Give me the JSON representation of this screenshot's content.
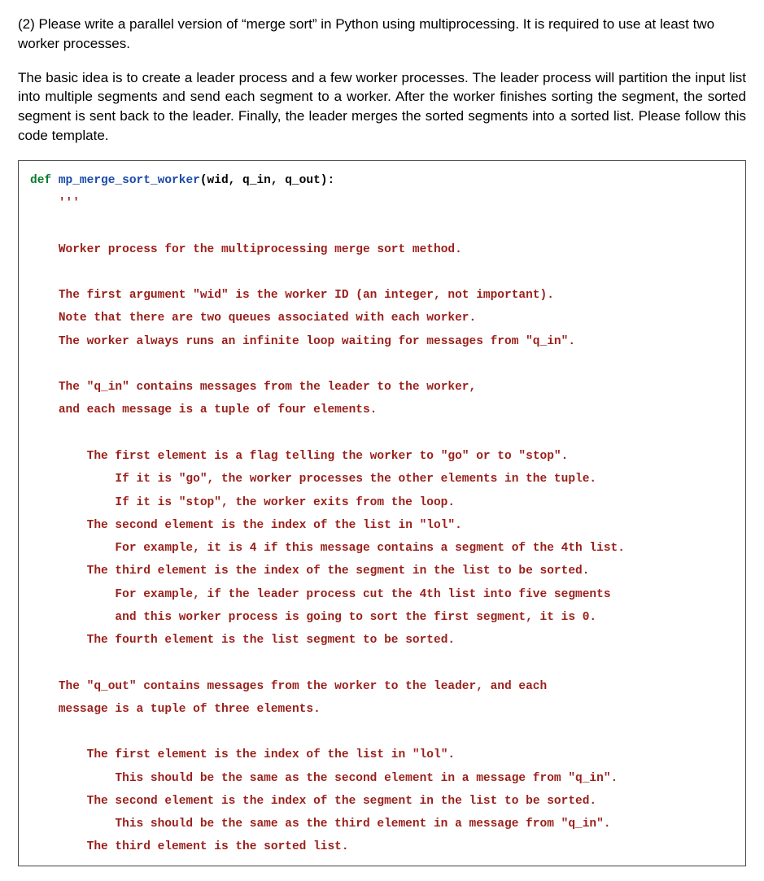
{
  "question": {
    "number": "(2)",
    "prompt1": "Please write a parallel version of “merge sort” in Python using multiprocessing. It is required to use at least two worker processes.",
    "prompt2": "The basic idea is to create a leader process and a few worker processes. The leader process will partition the input list into multiple segments and send each segment to a worker. After the worker finishes sorting the segment, the sorted segment is sent back to the leader. Finally, the leader merges the sorted segments into a sorted list. Please follow this code template."
  },
  "code": {
    "kw_def": "def",
    "fn_name": "mp_merge_sort_worker",
    "params": "(wid, q_in, q_out):",
    "doc": {
      "open": "'''",
      "l01": "Worker process for the multiprocessing merge sort method.",
      "l02": "The first argument \"wid\" is the worker ID (an integer, not important).",
      "l03": "Note that there are two queues associated with each worker.",
      "l04": "The worker always runs an infinite loop waiting for messages from \"q_in\".",
      "l05": "The \"q_in\" contains messages from the leader to the worker,",
      "l06": "and each message is a tuple of four elements.",
      "l07": "The first element is a flag telling the worker to \"go\" or to \"stop\".",
      "l08": "If it is \"go\", the worker processes the other elements in the tuple.",
      "l09": "If it is \"stop\", the worker exits from the loop.",
      "l10": "The second element is the index of the list in \"lol\".",
      "l11": "For example, it is 4 if this message contains a segment of the 4th list.",
      "l12": "The third element is the index of the segment in the list to be sorted.",
      "l13": "For example, if the leader process cut the 4th list into five segments",
      "l14": "and this worker process is going to sort the first segment, it is 0.",
      "l15": "The fourth element is the list segment to be sorted.",
      "l16": "The \"q_out\" contains messages from the worker to the leader, and each",
      "l17": "message is a tuple of three elements.",
      "l18": "The first element is the index of the list in \"lol\".",
      "l19": "This should be the same as the second element in a message from \"q_in\".",
      "l20": "The second element is the index of the segment in the list to be sorted.",
      "l21": "This should be the same as the third element in a message from \"q_in\".",
      "l22": "The third element is the sorted list."
    }
  }
}
